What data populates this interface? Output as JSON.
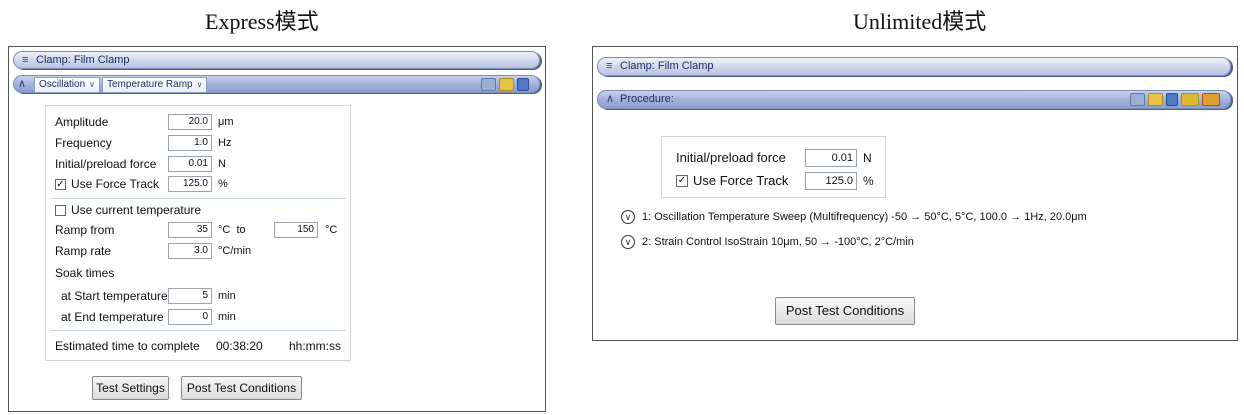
{
  "captions": {
    "left": "Express模式",
    "right": "Unlimited模式"
  },
  "express": {
    "clamp_bar": "Clamp: Film Clamp",
    "mode_dropdown": "Oscillation",
    "test_dropdown": "Temperature Ramp",
    "fields": {
      "amplitude": {
        "label": "Amplitude",
        "value": "20.0",
        "unit": "μm"
      },
      "frequency": {
        "label": "Frequency",
        "value": "1.0",
        "unit": "Hz"
      },
      "preload": {
        "label": "Initial/preload force",
        "value": "0.01",
        "unit": "N"
      },
      "force_track": {
        "label": "Use Force Track",
        "value": "125.0",
        "unit": "%",
        "checked": "✓"
      }
    },
    "use_current_temp": {
      "label": "Use current temperature",
      "checked": ""
    },
    "ramp_from": {
      "label": "Ramp from",
      "value": "35",
      "unit": "°C  to",
      "to_value": "150",
      "to_unit": "°C"
    },
    "ramp_rate": {
      "label": "Ramp rate",
      "value": "3.0",
      "unit": "°C/min"
    },
    "soak_times": "Soak times",
    "start_temp": {
      "label": "at Start temperature",
      "value": "5",
      "unit": "min"
    },
    "end_temp": {
      "label": "at End temperature",
      "value": "0",
      "unit": "min"
    },
    "estimate": {
      "label": "Estimated time to complete",
      "value": "00:38:20",
      "unit": "hh:mm:ss"
    },
    "buttons": {
      "test_settings": "Test Settings",
      "post_test": "Post Test Conditions"
    }
  },
  "unlimited": {
    "clamp_bar": "Clamp: Film Clamp",
    "procedure_bar": "Procedure:",
    "preload": {
      "label": "Initial/preload force",
      "value": "0.01",
      "unit": "N"
    },
    "force_track": {
      "label": "Use Force Track",
      "value": "125.0",
      "unit": "%",
      "checked": "✓"
    },
    "steps": [
      "1: Oscillation Temperature Sweep (Multifrequency) -50 → 50°C,  5°C,  100.0 → 1Hz,  20.0μm",
      "2: Strain Control IsoStrain 10μm, 50 → -100°C, 2°C/min"
    ],
    "post_test": "Post Test Conditions"
  },
  "icon_names": [
    "chevron-down-icon",
    "chevron-up-icon",
    "dropdown-arrow-icon",
    "wand-icon",
    "folder-icon",
    "save-icon",
    "add-step-icon",
    "remove-step-icon",
    "expand-circle-icon"
  ]
}
